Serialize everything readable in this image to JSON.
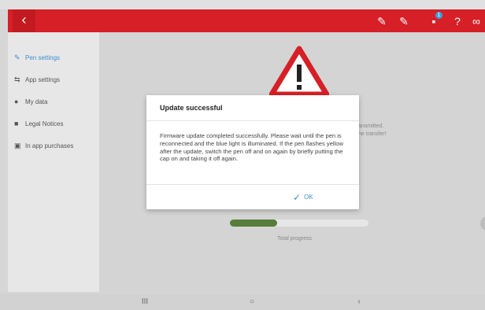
{
  "appbar": {
    "back_icon": "‹",
    "actions": [
      {
        "name": "pen-check-icon",
        "glyph": "✎"
      },
      {
        "name": "pen-dropdown-icon",
        "glyph": "✎"
      },
      {
        "name": "message-icon",
        "glyph": "▪",
        "badge": "1"
      },
      {
        "name": "help-icon",
        "glyph": "?"
      },
      {
        "name": "link-icon",
        "glyph": "∞"
      }
    ]
  },
  "sidebar": {
    "items": [
      {
        "label": "Pen settings",
        "icon": "pen-icon",
        "glyph": "✎",
        "active": true
      },
      {
        "label": "App settings",
        "icon": "app-settings-icon",
        "glyph": "⇆",
        "active": false
      },
      {
        "label": "My data",
        "icon": "location-icon",
        "glyph": "●",
        "active": false
      },
      {
        "label": "Legal Notices",
        "icon": "chat-icon",
        "glyph": "■",
        "active": false
      },
      {
        "label": "In app purchases",
        "icon": "cart-icon",
        "glyph": "▣",
        "active": false
      }
    ]
  },
  "background": {
    "text_right_1": "ansmitted.",
    "text_right_2": "he transfer!",
    "progress_label": "Total progress",
    "progress_fraction": 0.34
  },
  "dialog": {
    "title": "Update successful",
    "body": "Firmware update completed successfully. Please wait until the pen is reconnected and the blue light is illuminated. If the pen flashes yellow after the update, switch the pen off and on again by briefly putting the cap on and taking it off again.",
    "ok_label": "OK"
  },
  "navbar": {
    "recents": "III",
    "home": "○",
    "back": "‹"
  },
  "colors": {
    "appbar": "#d61f26",
    "accent": "#3b8fd1",
    "progress": "#567d3a"
  }
}
